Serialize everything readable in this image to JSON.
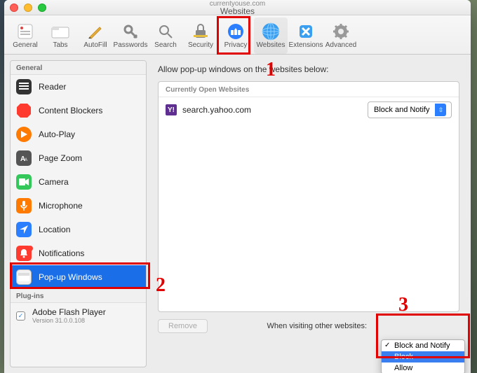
{
  "window": {
    "title_top": "currentyouse.com",
    "title_sub": "Websites"
  },
  "toolbar": [
    {
      "label": "General"
    },
    {
      "label": "Tabs"
    },
    {
      "label": "AutoFill"
    },
    {
      "label": "Passwords"
    },
    {
      "label": "Search"
    },
    {
      "label": "Security"
    },
    {
      "label": "Privacy"
    },
    {
      "label": "Websites"
    },
    {
      "label": "Extensions"
    },
    {
      "label": "Advanced"
    }
  ],
  "sidebar": {
    "general_head": "General",
    "plugins_head": "Plug-ins",
    "items": [
      {
        "label": "Reader"
      },
      {
        "label": "Content Blockers"
      },
      {
        "label": "Auto-Play"
      },
      {
        "label": "Page Zoom"
      },
      {
        "label": "Camera"
      },
      {
        "label": "Microphone"
      },
      {
        "label": "Location"
      },
      {
        "label": "Notifications"
      },
      {
        "label": "Pop-up Windows"
      }
    ],
    "plugin": {
      "label": "Adobe Flash Player",
      "sub": "Version 31.0.0.108"
    }
  },
  "main": {
    "section_label": "Allow pop-up windows on the websites below:",
    "panel_head": "Currently Open Websites",
    "site": {
      "icon": "Y!",
      "name": "search.yahoo.com",
      "policy": "Block and Notify"
    },
    "remove_label": "Remove",
    "bottom_label": "When visiting other websites:"
  },
  "menu": {
    "opt1": "Block and Notify",
    "opt2": "Block",
    "opt3": "Allow"
  },
  "annotations": {
    "n1": "1",
    "n2": "2",
    "n3": "3"
  }
}
